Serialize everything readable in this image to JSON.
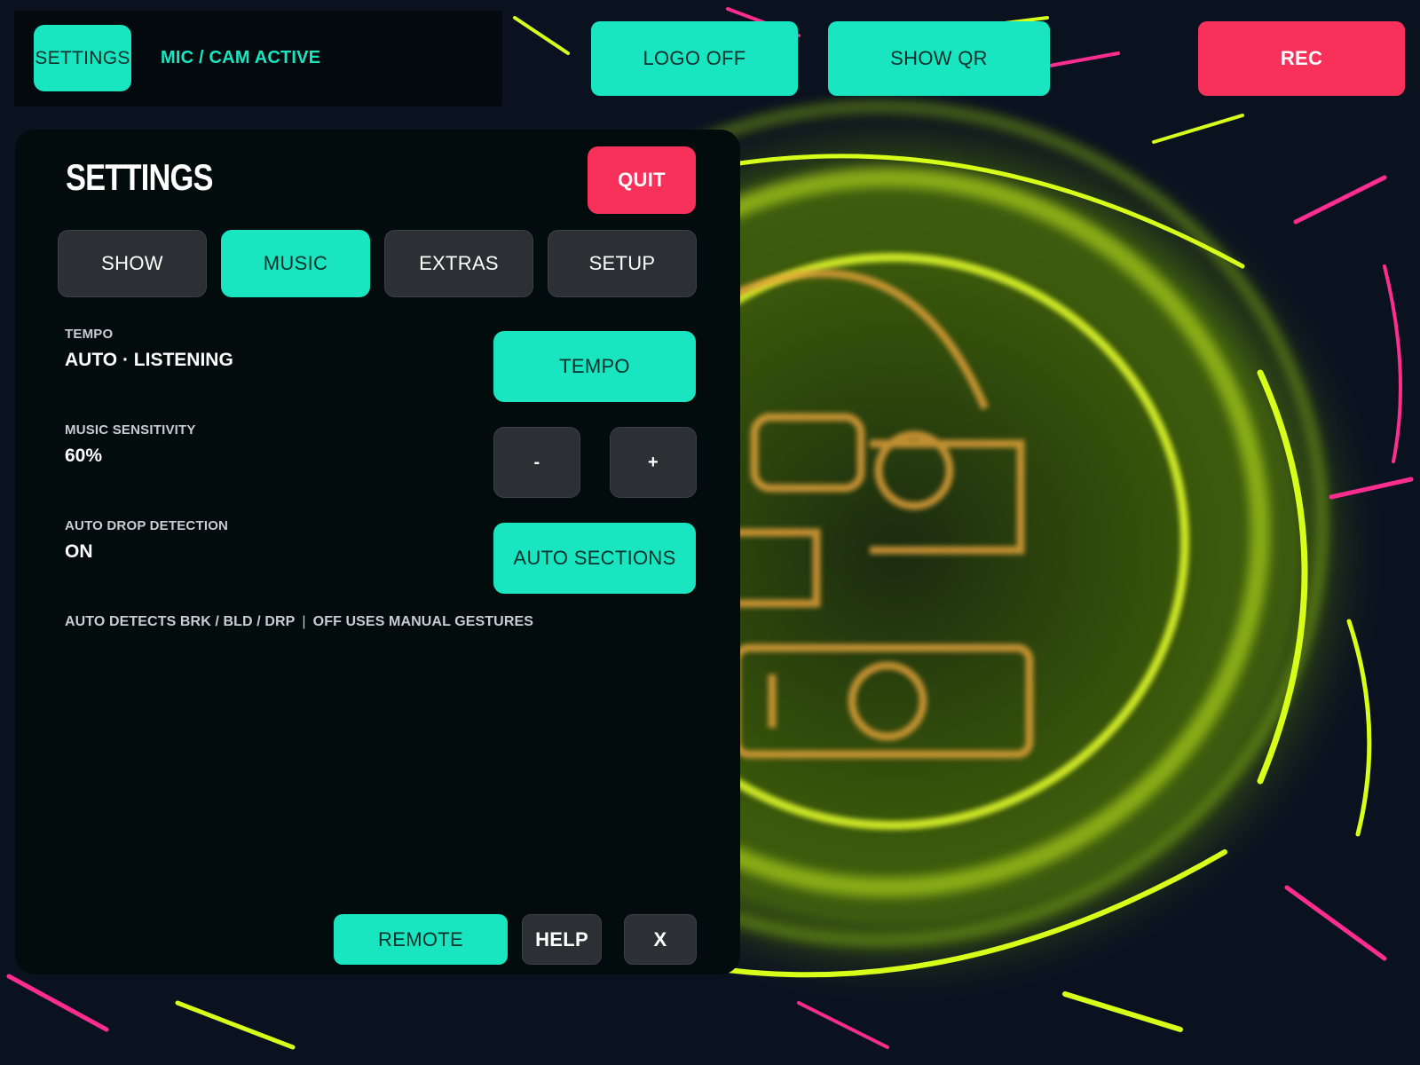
{
  "topbar": {
    "settings_label": "SETTINGS",
    "mic_status": "MIC / CAM ACTIVE",
    "logo_label": "LOGO OFF",
    "qr_label": "SHOW QR",
    "rec_label": "REC"
  },
  "panel": {
    "title": "SETTINGS",
    "quit_label": "QUIT",
    "tabs": [
      {
        "label": "SHOW",
        "active": false
      },
      {
        "label": "MUSIC",
        "active": true
      },
      {
        "label": "EXTRAS",
        "active": false
      },
      {
        "label": "SETUP",
        "active": false
      }
    ],
    "tempo": {
      "label": "TEMPO",
      "value": "AUTO · LISTENING",
      "button": "TEMPO"
    },
    "sensitivity": {
      "label": "MUSIC SENSITIVITY",
      "value": "60%",
      "minus": "-",
      "plus": "+"
    },
    "drop": {
      "label": "AUTO DROP DETECTION",
      "value": "ON",
      "button": "AUTO SECTIONS"
    },
    "note_left": "AUTO DETECTS BRK / BLD / DRP",
    "note_sep": "|",
    "note_right": "OFF USES MANUAL GESTURES",
    "footer": {
      "remote": "REMOTE",
      "help": "HELP",
      "close": "X"
    }
  },
  "colors": {
    "accent": "#19e6c1",
    "danger": "#f8315a",
    "panel_bg": "#020c0c",
    "button_dark": "#2c2f33",
    "backdrop": "#0a1220",
    "neon_yellow": "#d8ff1a",
    "neon_pink": "#ff2d8f",
    "logo_orange": "#e8a43a"
  }
}
